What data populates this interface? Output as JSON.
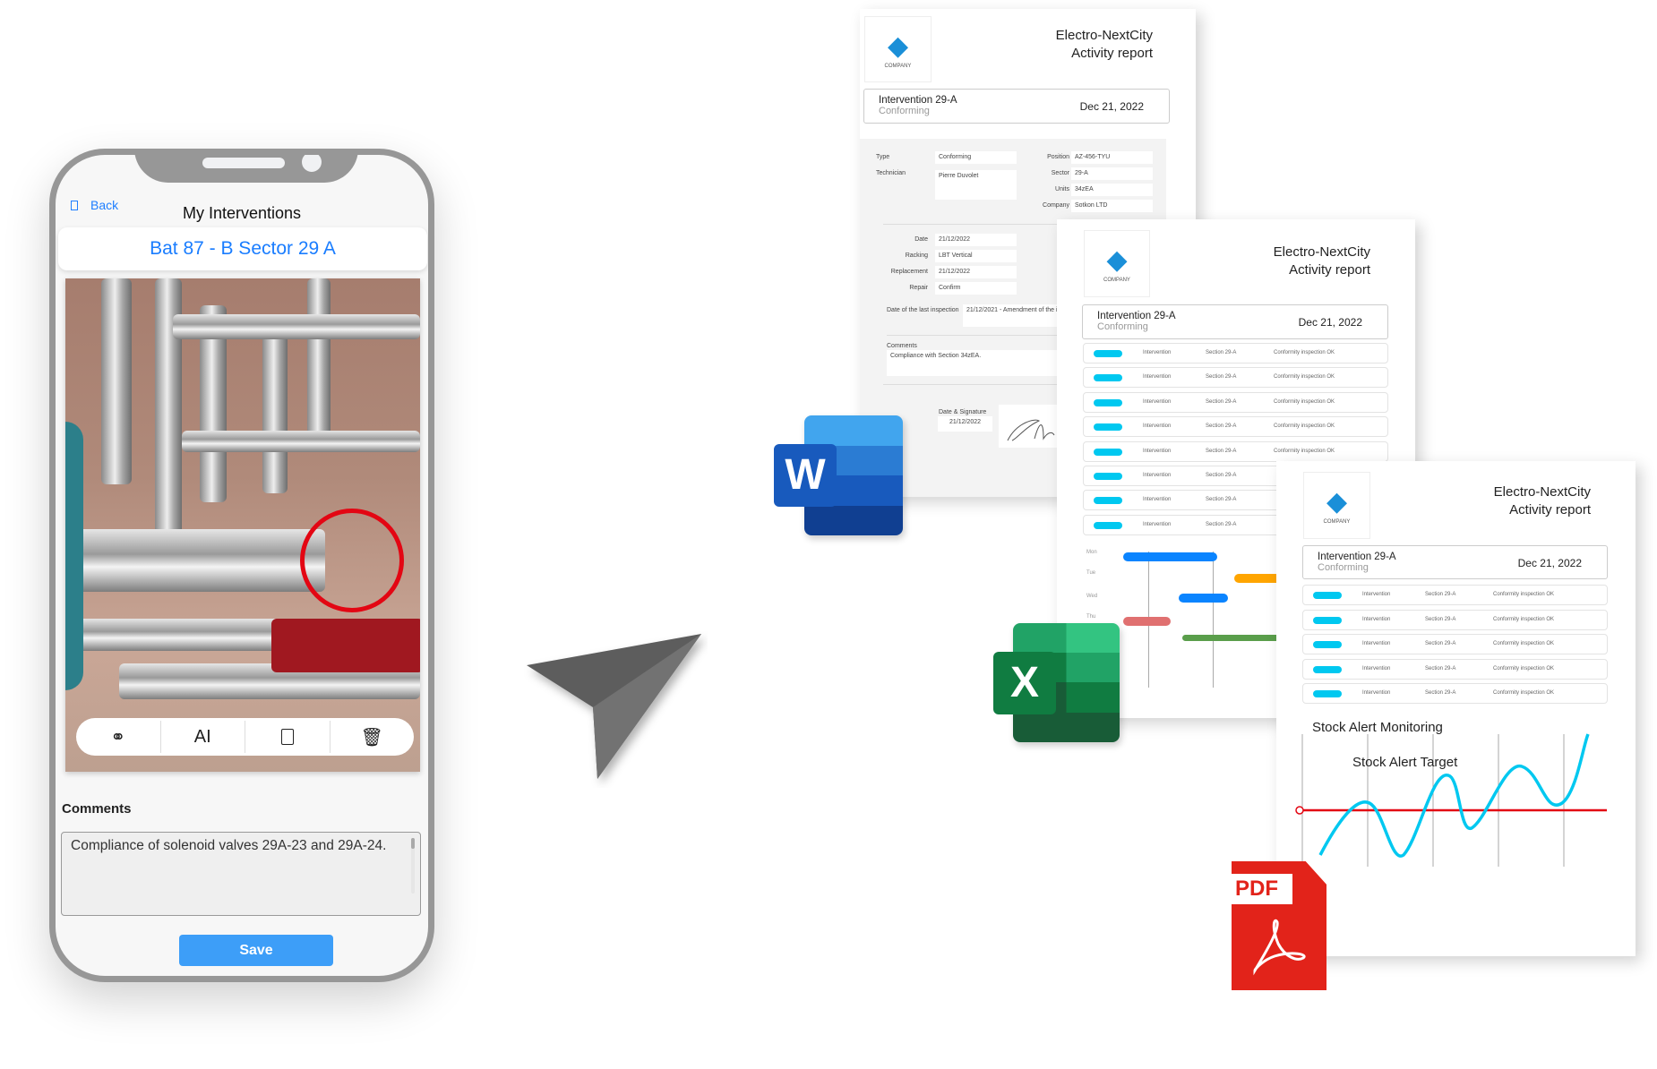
{
  "phone": {
    "back_label": "Back",
    "title": "My Interventions",
    "location": "Bat 87 - B Sector 29 A",
    "toolbar": [
      {
        "icon": "annotate-pen-icon"
      },
      {
        "icon": "text-icon",
        "glyph": "AI"
      },
      {
        "icon": "document-icon"
      },
      {
        "icon": "trash-icon"
      }
    ],
    "comments_label": "Comments",
    "comments_value": "Compliance of solenoid valves 29A-23 and 29A-24.",
    "save_label": "Save",
    "accent": "#1a7dff",
    "save_color": "#3d9ef8",
    "highlight_color": "#e30613"
  },
  "send_icon": "paper-plane-icon",
  "reports": {
    "company": "Electro-NextCity",
    "report_title": "Activity report",
    "logo_text": "COMPANY",
    "intervention": "Intervention 29-A",
    "status": "Conforming",
    "date": "Dec 21, 2022",
    "word_doc": {
      "icon_letter": "W",
      "fields": {
        "type_label": "Type",
        "type_value": "Conforming",
        "technician_label": "Technician",
        "technician_value": "Pierre Duvolet",
        "position_label": "Position",
        "position_value": "AZ-456-TYU",
        "sector_label": "Sector",
        "sector_value": "29-A",
        "units_label": "Units",
        "units_value": "34zEA",
        "company_label": "Company",
        "company_value": "Sotkon LTD",
        "date_label": "Date",
        "date_value": "21/12/2022",
        "racking_label": "Racking",
        "racking_value": "LBT Vertical",
        "replacement_label": "Replacement",
        "replacement_value": "21/12/2022",
        "repair_label": "Repair",
        "repair_value": "Confirm",
        "last_inspection_label": "Date of the last inspection",
        "last_inspection_value": "21/12/2021 - Amendment of the i",
        "comments_label": "Comments",
        "comments_value": "Compliance with Section 34zEA.",
        "signature_label": "Date & Signature",
        "signature_date": "21/12/2022"
      }
    },
    "excel_doc": {
      "icon_letter": "X",
      "rows": [
        {
          "type": "Intervention",
          "section": "Section 29-A",
          "result": "Conformity inspection OK"
        },
        {
          "type": "Intervention",
          "section": "Section 29-A",
          "result": "Conformity inspection OK"
        },
        {
          "type": "Intervention",
          "section": "Section 29-A",
          "result": "Conformity inspection OK"
        },
        {
          "type": "Intervention",
          "section": "Section 29-A",
          "result": "Conformity inspection OK"
        },
        {
          "type": "Intervention",
          "section": "Section 29-A",
          "result": "Conformity inspection OK"
        },
        {
          "type": "Intervention",
          "section": "Section 29-A",
          "result": ""
        },
        {
          "type": "Intervention",
          "section": "Section 29-A",
          "result": ""
        },
        {
          "type": "Intervention",
          "section": "Section 29-A",
          "result": ""
        }
      ],
      "gantt_days": [
        "Mon",
        "Tue",
        "Wed",
        "Thu"
      ],
      "gantt_colors": [
        "#0a84ff",
        "#ffa500",
        "#0a84ff",
        "#e07070",
        "#5a9e4b"
      ]
    },
    "pdf_doc": {
      "icon_label": "PDF",
      "rows": [
        {
          "type": "Intervention",
          "section": "Section 29-A",
          "result": "Conformity inspection OK"
        },
        {
          "type": "Intervention",
          "section": "Section 29-A",
          "result": "Conformity inspection OK"
        },
        {
          "type": "Intervention",
          "section": "Section 29-A",
          "result": "Conformity inspection OK"
        },
        {
          "type": "Intervention",
          "section": "Section 29-A",
          "result": "Conformity inspection OK"
        },
        {
          "type": "Intervention",
          "section": "Section 29-A",
          "result": "Conformity inspection OK"
        }
      ],
      "chart_title": "Stock Alert Monitoring",
      "chart_target_label": "Stock Alert Target",
      "series_color": "#00c8f0",
      "target_color": "#e30613"
    }
  }
}
